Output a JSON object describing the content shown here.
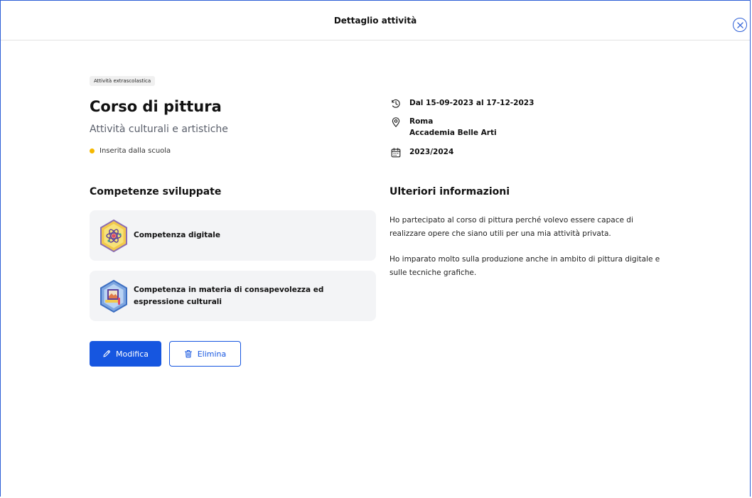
{
  "header": {
    "title": "Dettaglio attività"
  },
  "activity": {
    "tag": "Attività extrascolastica",
    "title": "Corso di pittura",
    "subtitle": "Attività culturali e artistiche",
    "status": "Inserita dalla scuola",
    "status_color": "#f5b800"
  },
  "details": {
    "dates": "Dal 15-09-2023 al 17-12-2023",
    "city": "Roma",
    "place": "Accademia Belle Arti",
    "year": "2023/2024"
  },
  "competences": {
    "title": "Competenze sviluppate",
    "items": [
      {
        "label": "Competenza digitale",
        "icon": "digital-competence-badge-icon"
      },
      {
        "label_line1": "Competenza in materia di consapevolezza ed",
        "label_line2": "espressione culturali",
        "icon": "cultural-competence-badge-icon"
      }
    ]
  },
  "more_info": {
    "title": "Ulteriori informazioni",
    "paragraph1_line1": "Ho partecipato al corso di pittura perché volevo essere capace di",
    "paragraph1_line2": "realizzare opere che siano utili per una mia attività privata.",
    "paragraph2_line1": "Ho imparato molto sulla produzione anche in ambito di pittura digitale e",
    "paragraph2_line2": "sulle tecniche grafiche."
  },
  "actions": {
    "edit_label": "Modifica",
    "delete_label": "Elimina"
  },
  "colors": {
    "accent": "#1656e0",
    "frame": "#2d5fd6"
  }
}
